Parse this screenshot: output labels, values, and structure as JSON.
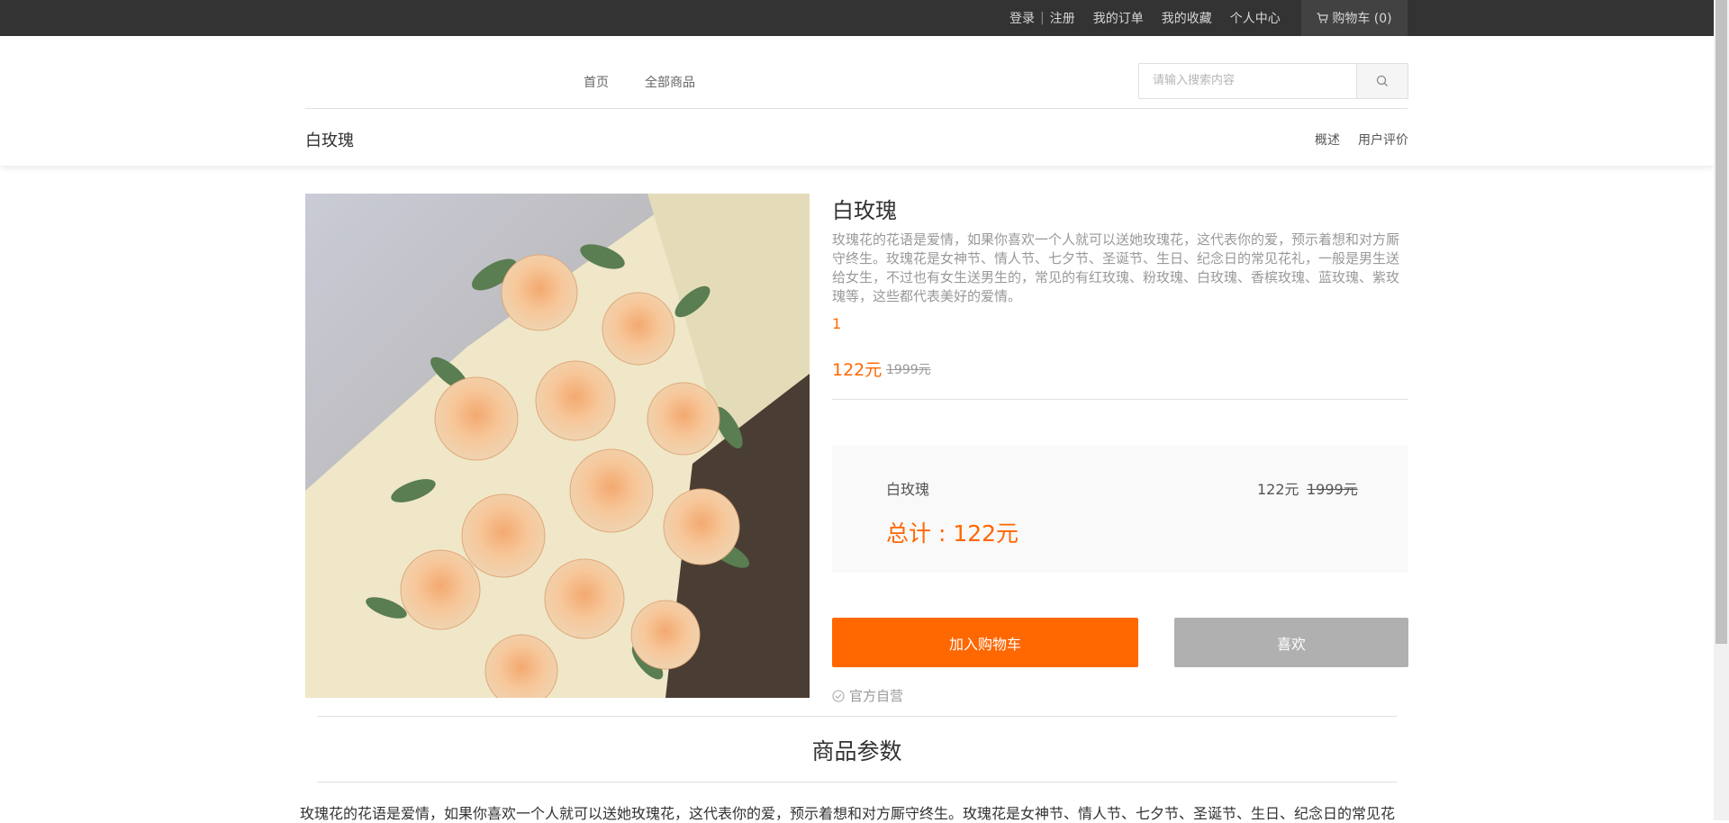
{
  "topbar": {
    "login": "登录",
    "separator": "|",
    "register": "注册",
    "orders": "我的订单",
    "favorites": "我的收藏",
    "personal": "个人中心",
    "cart": "购物车 (0)"
  },
  "header": {
    "nav": [
      "首页",
      "全部商品"
    ],
    "search_placeholder": "请输入搜索内容",
    "sub_title": "白玫瑰",
    "sub_links": [
      "概述",
      "用户评价"
    ]
  },
  "product": {
    "title": "白玫瑰",
    "description": "玫瑰花的花语是爱情，如果你喜欢一个人就可以送她玫瑰花，这代表你的爱，预示着想和对方厮守终生。玫瑰花是女神节、情人节、七夕节、圣诞节、生日、纪念日的常见花礼，一般是男生送给女生，不过也有女生送男生的，常见的有红玫瑰、粉玫瑰、白玫瑰、香槟玫瑰、蓝玫瑰、紫玫瑰等，这些都代表美好的爱情。",
    "quantity": "1",
    "price": "122元",
    "old_price": "1999元"
  },
  "summary": {
    "name": "白玫瑰",
    "price": "122元",
    "old_price": "1999元",
    "total": "总计 : 122元"
  },
  "buttons": {
    "add_to_cart": "加入购物车",
    "like": "喜欢"
  },
  "official": "官方自营",
  "params": {
    "title": "商品参数",
    "text": "玫瑰花的花语是爱情，如果你喜欢一个人就可以送她玫瑰花，这代表你的爱，预示着想和对方厮守终生。玫瑰花是女神节、情人节、七夕节、圣诞节、生日、纪念日的常见花"
  },
  "colors": {
    "accent": "#ff6700",
    "topbar": "#333333",
    "like_button": "#b0b0b0"
  }
}
